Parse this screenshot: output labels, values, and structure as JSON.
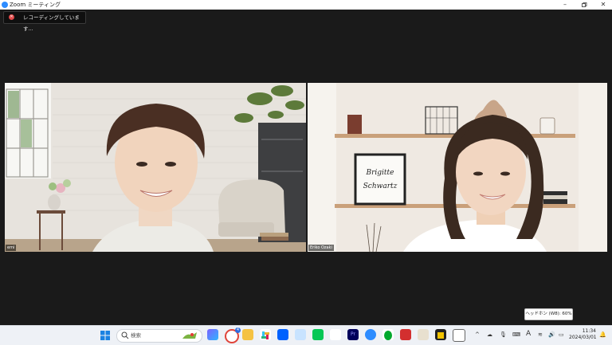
{
  "window": {
    "title": "Zoom ミーティング"
  },
  "recording": {
    "label": "レコーディングしています..."
  },
  "participants": [
    {
      "name": "emi"
    },
    {
      "name": "Eriko Ozaki"
    }
  ],
  "decor": {
    "frame_text_1": "Brigitte",
    "frame_text_2": "Schwartz"
  },
  "volume_tooltip": {
    "text": "ヘッドホン (W8): 60%"
  },
  "taskbar": {
    "search_placeholder": "検索",
    "notification_badge": "4",
    "tray": {
      "ime": "A"
    },
    "clock": {
      "time": "11:34",
      "date": "2024/03/01"
    }
  },
  "colors": {
    "zoom_blue": "#2d8cff",
    "recording_red": "#e24b4b",
    "background": "#1a1a1a"
  }
}
